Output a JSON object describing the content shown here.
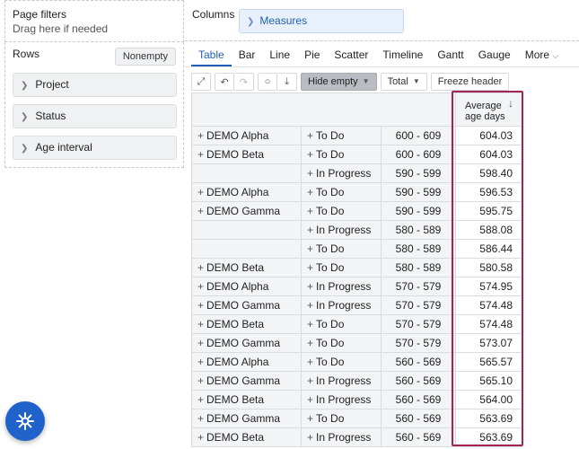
{
  "page_filters": {
    "title": "Page filters",
    "hint": "Drag here if needed"
  },
  "rows_panel": {
    "title": "Rows",
    "nonempty_label": "Nonempty",
    "dimensions": [
      "Project",
      "Status",
      "Age interval"
    ]
  },
  "columns": {
    "title": "Columns",
    "measures_label": "Measures"
  },
  "tabs": [
    "Table",
    "Bar",
    "Line",
    "Pie",
    "Scatter",
    "Timeline",
    "Gantt",
    "Gauge",
    "More"
  ],
  "active_tab": "Table",
  "toolbar": {
    "hide_empty_label": "Hide empty",
    "total_label": "Total",
    "freeze_header_label": "Freeze header"
  },
  "table": {
    "measure_header_line1": "Average",
    "measure_header_line2": "age days",
    "rows": [
      {
        "project": "DEMO Alpha",
        "status": "To Do",
        "age": "600 - 609",
        "value": "604.03"
      },
      {
        "project": "DEMO Beta",
        "status": "To Do",
        "age": "600 - 609",
        "value": "604.03"
      },
      {
        "project": "",
        "status": "In Progress",
        "age": "590 - 599",
        "value": "598.40"
      },
      {
        "project": "DEMO Alpha",
        "status": "To Do",
        "age": "590 - 599",
        "value": "596.53"
      },
      {
        "project": "DEMO Gamma",
        "status": "To Do",
        "age": "590 - 599",
        "value": "595.75"
      },
      {
        "project": "",
        "status": "In Progress",
        "age": "580 - 589",
        "value": "588.08"
      },
      {
        "project": "",
        "status": "To Do",
        "age": "580 - 589",
        "value": "586.44"
      },
      {
        "project": "DEMO Beta",
        "status": "To Do",
        "age": "580 - 589",
        "value": "580.58"
      },
      {
        "project": "DEMO Alpha",
        "status": "In Progress",
        "age": "570 - 579",
        "value": "574.95"
      },
      {
        "project": "DEMO Gamma",
        "status": "In Progress",
        "age": "570 - 579",
        "value": "574.48"
      },
      {
        "project": "DEMO Beta",
        "status": "To Do",
        "age": "570 - 579",
        "value": "574.48"
      },
      {
        "project": "DEMO Gamma",
        "status": "To Do",
        "age": "570 - 579",
        "value": "573.07"
      },
      {
        "project": "DEMO Alpha",
        "status": "To Do",
        "age": "560 - 569",
        "value": "565.57"
      },
      {
        "project": "DEMO Gamma",
        "status": "In Progress",
        "age": "560 - 569",
        "value": "565.10"
      },
      {
        "project": "DEMO Beta",
        "status": "In Progress",
        "age": "560 - 569",
        "value": "564.00"
      },
      {
        "project": "DEMO Gamma",
        "status": "To Do",
        "age": "560 - 569",
        "value": "563.69"
      },
      {
        "project": "DEMO Beta",
        "status": "In Progress",
        "age": "560 - 569",
        "value": "563.69"
      }
    ]
  },
  "icons": {
    "expand": "expand-icon",
    "undo": "undo-icon",
    "redo": "redo-icon",
    "comment": "comment-icon",
    "export": "export-icon",
    "sort": "sort-down-icon",
    "help": "help-fab-icon"
  },
  "colors": {
    "accent": "#1f5fb7",
    "highlight_box": "#a12456",
    "help_button": "#1f62c9"
  }
}
